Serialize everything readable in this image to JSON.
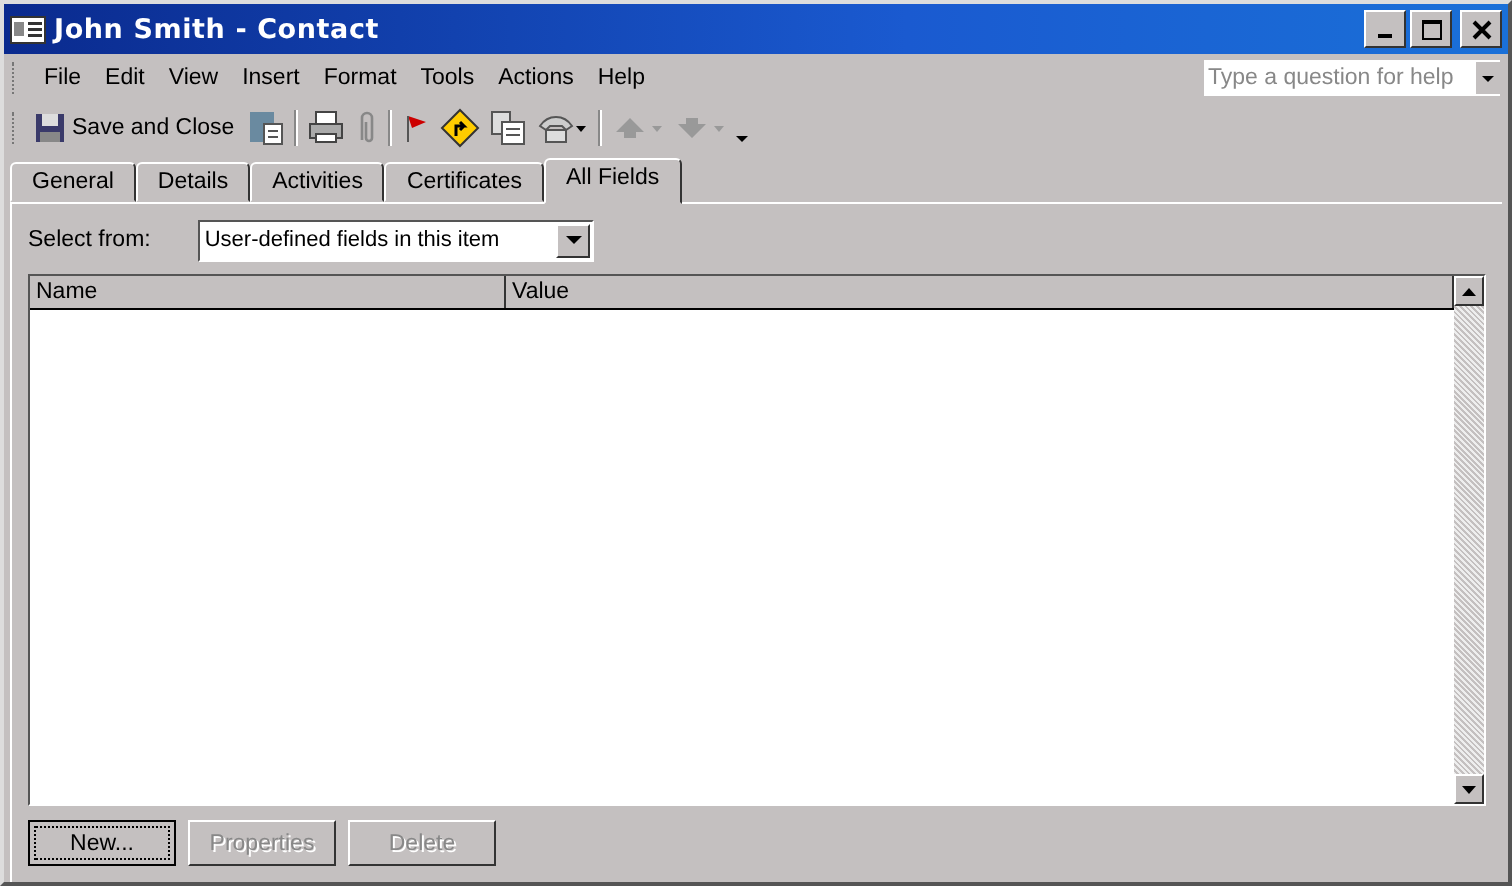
{
  "window": {
    "title": "John Smith - Contact"
  },
  "menu": [
    "File",
    "Edit",
    "View",
    "Insert",
    "Format",
    "Tools",
    "Actions",
    "Help"
  ],
  "help_box": {
    "placeholder": "Type a question for help"
  },
  "toolbar": {
    "save_label": "Save and Close"
  },
  "tabs": [
    {
      "label": "General",
      "selected": false
    },
    {
      "label": "Details",
      "selected": false
    },
    {
      "label": "Activities",
      "selected": false
    },
    {
      "label": "Certificates",
      "selected": false
    },
    {
      "label": "All Fields",
      "selected": true
    }
  ],
  "select_from": {
    "label": "Select from:",
    "value": "User-defined fields in this item"
  },
  "table": {
    "columns": [
      "Name",
      "Value"
    ]
  },
  "buttons": [
    {
      "label": "New...",
      "disabled": false
    },
    {
      "label": "Properties",
      "disabled": true
    },
    {
      "label": "Delete",
      "disabled": true
    }
  ]
}
